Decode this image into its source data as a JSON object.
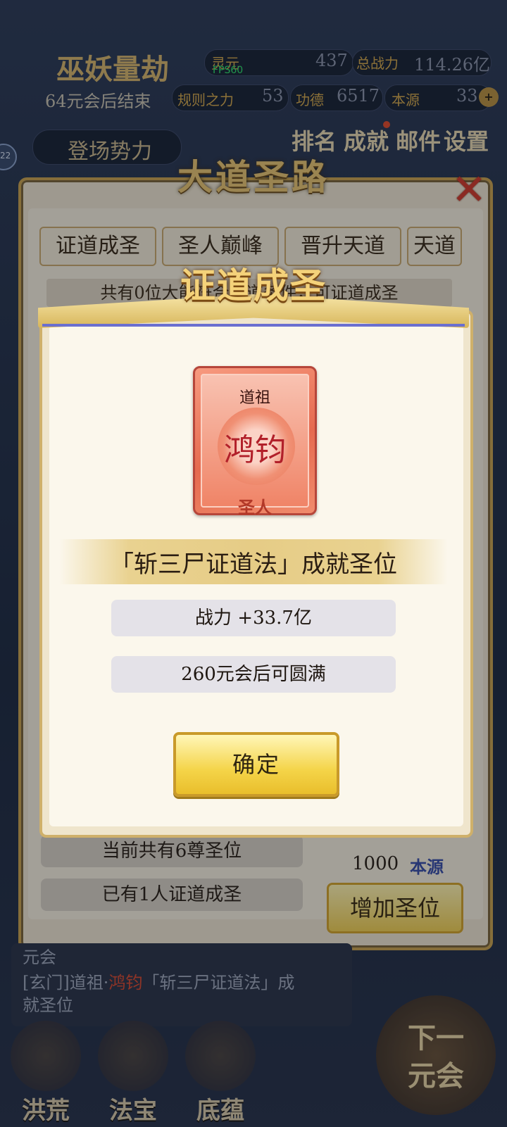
{
  "background": {
    "title": "巫妖量劫",
    "stat_label_1": "灵元",
    "stat_value_1": "437",
    "power_label": "总战力",
    "power_value": "114.26亿",
    "countdown": "64元会后结束",
    "law_label": "规则之力",
    "law_value": "53",
    "merit_label": "功德",
    "merit_value": "6517",
    "origin_label": "本源",
    "origin_value": "33",
    "factions_button": "登场势力",
    "menu_rank": "排名",
    "menu_achieve": "成就",
    "menu_mail": "邮件",
    "menu_settings": "设置",
    "badge": "22",
    "fps": "FPS60"
  },
  "panel": {
    "title": "大道圣路",
    "tabs": [
      "证道成圣",
      "圣人巅峰",
      "晋升天道",
      "天道"
    ],
    "info_strip": "共有0位大能符合证道条件，可证道成圣",
    "current_positions": "当前共有6尊圣位",
    "ascended_count": "已有1人证道成圣",
    "cost_value": "1000",
    "cost_unit": "本源",
    "add_button": "增加圣位"
  },
  "log": {
    "line1": "元会",
    "line2_prefix": "[玄门]道祖·",
    "line2_name": "鸿钧",
    "line2_suffix": "「斩三尸证道法」成",
    "line3": "就圣位"
  },
  "nav": {
    "items": [
      "洪荒",
      "法宝",
      "底蕴"
    ],
    "next_line1": "下一",
    "next_line2": "元会"
  },
  "modal": {
    "title": "证道成圣",
    "card_top": "道祖",
    "card_name": "鸿钧",
    "card_rank": "圣人",
    "method": "「斩三尸证道法」成就圣位",
    "power_gain": "战力  +33.7亿",
    "duration": "260元会后可圆满",
    "confirm": "确定"
  },
  "colors": {
    "accent_gold": "#cfb06a",
    "button_yellow": "#f4d448",
    "card_red": "#e56a4f",
    "origin_blue": "#3a4ea6"
  }
}
